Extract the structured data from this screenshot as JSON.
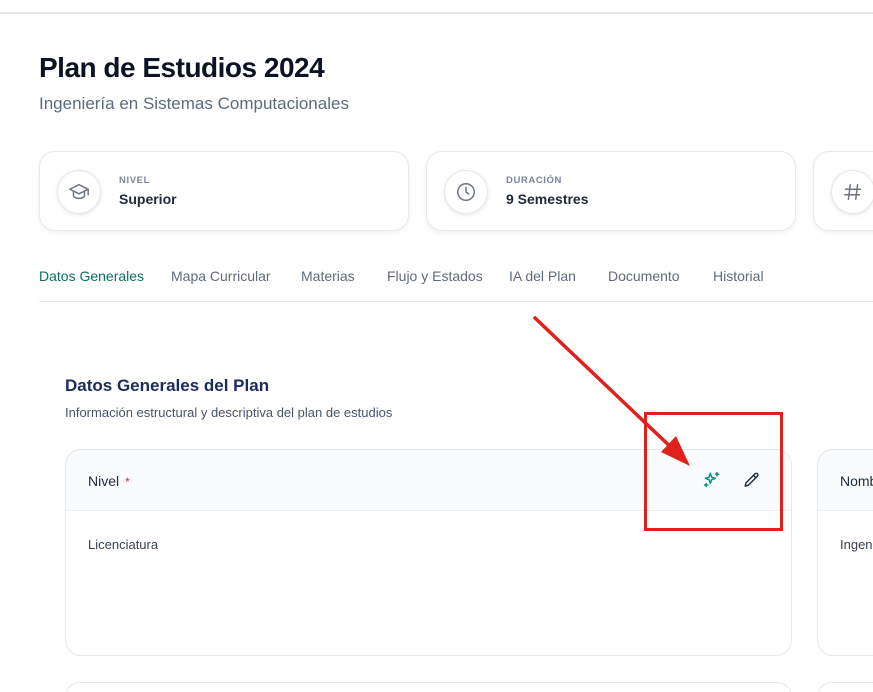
{
  "header": {
    "title": "Plan de Estudios 2024",
    "subtitle": "Ingeniería en Sistemas Computacionales"
  },
  "stats": [
    {
      "label": "NIVEL",
      "value": "Superior",
      "icon": "graduation-cap-icon"
    },
    {
      "label": "DURACIÓN",
      "value": "9 Semestres",
      "icon": "clock-icon"
    },
    {
      "label": "",
      "value": "",
      "icon": "hash-icon"
    }
  ],
  "tabs": [
    {
      "label": "Datos Generales",
      "active": true
    },
    {
      "label": "Mapa Curricular"
    },
    {
      "label": "Materias"
    },
    {
      "label": "Flujo y Estados"
    },
    {
      "label": "IA del Plan"
    },
    {
      "label": "Documento"
    },
    {
      "label": "Historial"
    }
  ],
  "section": {
    "title": "Datos Generales del Plan",
    "description": "Información estructural y descriptiva del plan de estudios"
  },
  "fields": [
    {
      "label": "Nivel",
      "required_mark": "*",
      "value": "Licenciatura"
    },
    {
      "label": "Nomb",
      "value": "Ingen"
    }
  ],
  "actions": {
    "ai_icon": "sparkles-icon",
    "edit_icon": "pencil-icon"
  },
  "colors": {
    "accent": "#0d6e63",
    "title": "#0b1324",
    "section_title": "#1a2b5e",
    "required": "#e11d48",
    "annotation": "#e0201d"
  }
}
